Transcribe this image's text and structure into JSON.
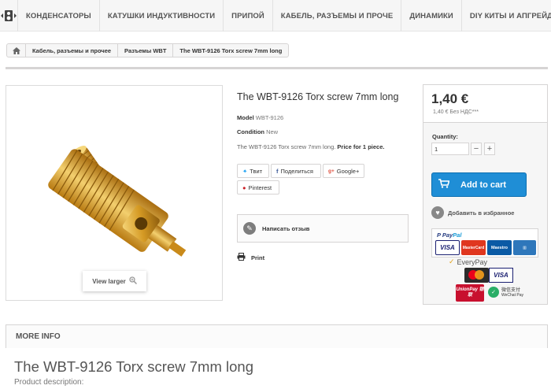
{
  "nav": {
    "items": [
      "Конденсаторы",
      "Катушки индуктивности",
      "Припой",
      "Кабель, разъемы и проче",
      "Динамики",
      "DIY киты и апгрейды"
    ]
  },
  "breadcrumb": {
    "items": [
      "Кабель, разъемы и прочее",
      "Разъемы WBT",
      "The WBT-9126 Torx screw 7mm long"
    ]
  },
  "image": {
    "view_larger": "View larger"
  },
  "product": {
    "title": "The WBT-9126 Torx screw 7mm long",
    "model_label": "Model",
    "model_value": "WBT-9126",
    "condition_label": "Condition",
    "condition_value": "New",
    "desc_text": "The WBT-9126 Torx screw 7mm long.",
    "desc_bold": "Price for 1 piece."
  },
  "social": {
    "tweet": "Твит",
    "share": "Поделиться",
    "google": "Google+",
    "pinterest": "Pinterest"
  },
  "review": {
    "label": "Написать отзыв"
  },
  "print": {
    "label": "Print"
  },
  "buy": {
    "price": "1,40 €",
    "price_tax": "1,40 € Без НДС***",
    "qty_label": "Quantity:",
    "qty_value": "1",
    "add_to_cart": "Add to cart",
    "wishlist": "Добавить в избранное"
  },
  "payments": {
    "paypal_a": "Pay",
    "paypal_b": "Pal",
    "visa": "VISA",
    "mastercard": "MasterCard",
    "maestro": "Maestro",
    "everypay": "EveryPay",
    "unionpay": "UnionPay 银联",
    "wechat_cn": "微信支付",
    "wechat_en": "WeChat Pay"
  },
  "more_info": {
    "heading": "More info",
    "title": "The WBT-9126 Torx screw 7mm long",
    "subtitle": "Product description:"
  },
  "colors": {
    "accent": "#1f8ed6",
    "border": "#d6d4d4",
    "gold": "#d9a32a"
  }
}
